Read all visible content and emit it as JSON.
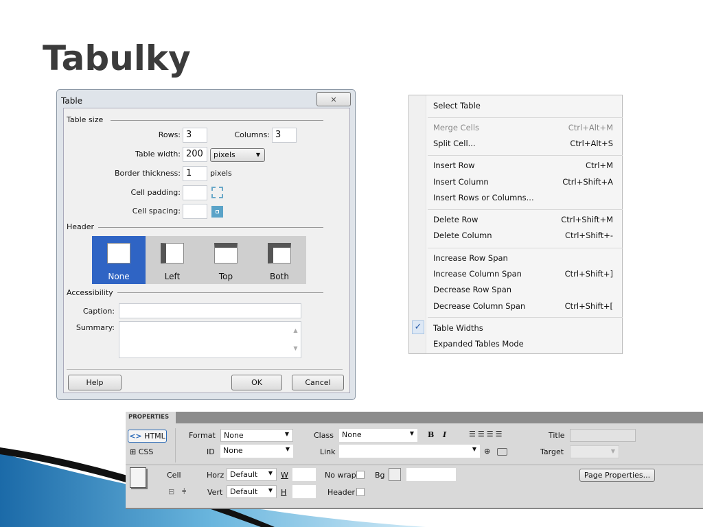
{
  "slide": {
    "title": "Tabulky"
  },
  "dialog": {
    "title": "Table",
    "close": "✕",
    "table_size": {
      "legend": "Table size",
      "rows_label": "Rows:",
      "rows": "3",
      "columns_label": "Columns:",
      "columns": "3",
      "width_label": "Table width:",
      "width": "200",
      "width_unit": "pixels",
      "border_label": "Border thickness:",
      "border": "1",
      "border_unit": "pixels",
      "padding_label": "Cell padding:",
      "padding": "",
      "spacing_label": "Cell spacing:",
      "spacing": ""
    },
    "header": {
      "legend": "Header",
      "options": [
        "None",
        "Left",
        "Top",
        "Both"
      ],
      "selected": "None"
    },
    "accessibility": {
      "legend": "Accessibility",
      "caption_label": "Caption:",
      "caption": "",
      "summary_label": "Summary:",
      "summary": ""
    },
    "buttons": {
      "help": "Help",
      "ok": "OK",
      "cancel": "Cancel"
    }
  },
  "menu": {
    "items": [
      {
        "label": "Select Table",
        "shortcut": ""
      },
      {
        "label": "Merge Cells",
        "shortcut": "Ctrl+Alt+M",
        "disabled": true
      },
      {
        "label": "Split Cell...",
        "shortcut": "Ctrl+Alt+S"
      },
      {
        "label": "Insert Row",
        "shortcut": "Ctrl+M"
      },
      {
        "label": "Insert Column",
        "shortcut": "Ctrl+Shift+A"
      },
      {
        "label": "Insert Rows or Columns...",
        "shortcut": ""
      },
      {
        "label": "Delete Row",
        "shortcut": "Ctrl+Shift+M"
      },
      {
        "label": "Delete Column",
        "shortcut": "Ctrl+Shift+-"
      },
      {
        "label": "Increase Row Span",
        "shortcut": ""
      },
      {
        "label": "Increase Column Span",
        "shortcut": "Ctrl+Shift+]"
      },
      {
        "label": "Decrease Row Span",
        "shortcut": ""
      },
      {
        "label": "Decrease Column Span",
        "shortcut": "Ctrl+Shift+["
      },
      {
        "label": "Table Widths",
        "shortcut": "",
        "checked": true
      },
      {
        "label": "Expanded Tables Mode",
        "shortcut": ""
      }
    ],
    "check": "✓"
  },
  "properties": {
    "tab": "PROPERTIES",
    "html": "HTML",
    "css": "CSS",
    "format_label": "Format",
    "format": "None",
    "id_label": "ID",
    "id": "None",
    "class_label": "Class",
    "class": "None",
    "link_label": "Link",
    "link": "",
    "bold": "B",
    "italic": "I",
    "title_label": "Title",
    "target_label": "Target",
    "cell_label": "Cell",
    "horz_label": "Horz",
    "horz": "Default",
    "vert_label": "Vert",
    "vert": "Default",
    "w_label": "W",
    "h_label": "H",
    "nowrap_label": "No wrap",
    "bg_label": "Bg",
    "header_label": "Header",
    "page_properties": "Page Properties..."
  }
}
